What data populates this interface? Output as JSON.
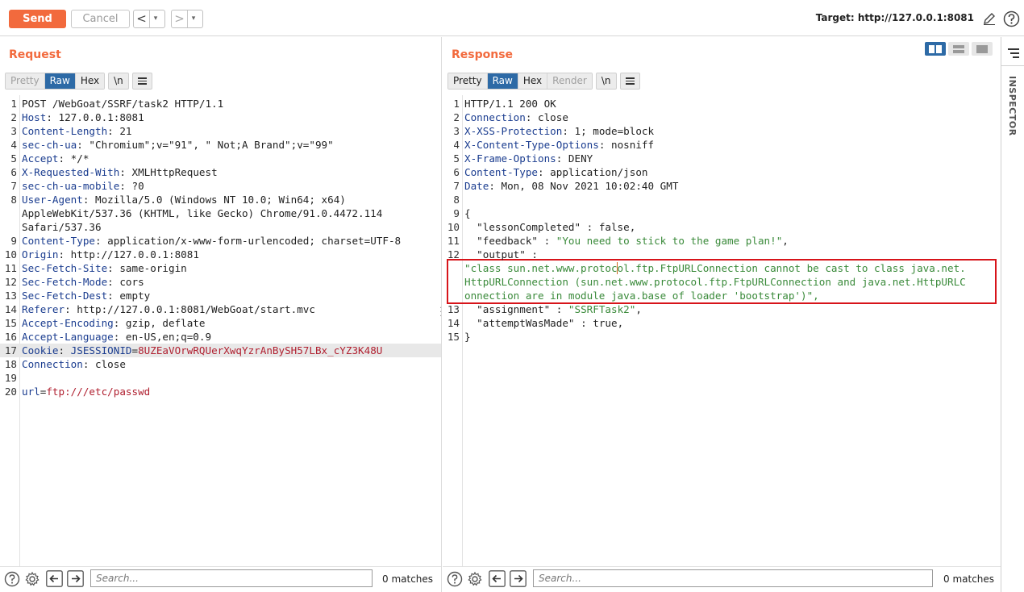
{
  "toolbar": {
    "send_label": "Send",
    "cancel_label": "Cancel",
    "back_glyph": "<",
    "forward_glyph": ">",
    "dropdown_glyph": "▾",
    "target_label": "Target: http://127.0.0.1:8081",
    "icons": [
      "edit-pencil-icon",
      "help-icon"
    ]
  },
  "request": {
    "title": "Request",
    "tabs": [
      "Pretty",
      "Raw",
      "Hex"
    ],
    "active_tab": "Raw",
    "newline_tab": "\\n",
    "lines": [
      {
        "n": "1",
        "name": "",
        "sep": "",
        "value": "POST /WebGoat/SSRF/task2 HTTP/1.1"
      },
      {
        "n": "2",
        "name": "Host",
        "sep": ": ",
        "value": "127.0.0.1:8081"
      },
      {
        "n": "3",
        "name": "Content-Length",
        "sep": ": ",
        "value": "21"
      },
      {
        "n": "4",
        "name": "sec-ch-ua",
        "sep": ": ",
        "value": "\"Chromium\";v=\"91\", \" Not;A Brand\";v=\"99\""
      },
      {
        "n": "5",
        "name": "Accept",
        "sep": ": ",
        "value": "*/*"
      },
      {
        "n": "6",
        "name": "X-Requested-With",
        "sep": ": ",
        "value": "XMLHttpRequest"
      },
      {
        "n": "7",
        "name": "sec-ch-ua-mobile",
        "sep": ": ",
        "value": "?0"
      },
      {
        "n": "8",
        "name": "User-Agent",
        "sep": ": ",
        "value": "Mozilla/5.0 (Windows NT 10.0; Win64; x64)"
      },
      {
        "n": "",
        "name": "",
        "sep": "",
        "value": "AppleWebKit/537.36 (KHTML, like Gecko) Chrome/91.0.4472.114"
      },
      {
        "n": "",
        "name": "",
        "sep": "",
        "value": "Safari/537.36"
      },
      {
        "n": "9",
        "name": "Content-Type",
        "sep": ": ",
        "value": "application/x-www-form-urlencoded; charset=UTF-8"
      },
      {
        "n": "10",
        "name": "Origin",
        "sep": ": ",
        "value": "http://127.0.0.1:8081"
      },
      {
        "n": "11",
        "name": "Sec-Fetch-Site",
        "sep": ": ",
        "value": "same-origin"
      },
      {
        "n": "12",
        "name": "Sec-Fetch-Mode",
        "sep": ": ",
        "value": "cors"
      },
      {
        "n": "13",
        "name": "Sec-Fetch-Dest",
        "sep": ": ",
        "value": "empty"
      },
      {
        "n": "14",
        "name": "Referer",
        "sep": ": ",
        "value": "http://127.0.0.1:8081/WebGoat/start.mvc"
      },
      {
        "n": "15",
        "name": "Accept-Encoding",
        "sep": ": ",
        "value": "gzip, deflate"
      },
      {
        "n": "16",
        "name": "Accept-Language",
        "sep": ": ",
        "value": "en-US,en;q=0.9"
      },
      {
        "n": "17",
        "name": "Cookie",
        "sep": ": ",
        "value": "",
        "cookie_name": "JSESSIONID",
        "cookie_value": "8UZEaVOrwRQUerXwqYzrAnBySH57LBx_cYZ3K48U",
        "highlight": true
      },
      {
        "n": "18",
        "name": "Connection",
        "sep": ": ",
        "value": "close"
      },
      {
        "n": "19",
        "name": "",
        "sep": "",
        "value": ""
      },
      {
        "n": "20",
        "name": "url",
        "sep": "=",
        "value": "ftp:///etc/passwd",
        "body": true
      }
    ]
  },
  "response": {
    "title": "Response",
    "tabs": [
      "Pretty",
      "Raw",
      "Hex",
      "Render"
    ],
    "active_tab": "Raw",
    "newline_tab": "\\n",
    "headers": [
      {
        "n": "1",
        "name": "",
        "value": "HTTP/1.1 200 OK"
      },
      {
        "n": "2",
        "name": "Connection",
        "value": "close"
      },
      {
        "n": "3",
        "name": "X-XSS-Protection",
        "value": "1; mode=block"
      },
      {
        "n": "4",
        "name": "X-Content-Type-Options",
        "value": "nosniff"
      },
      {
        "n": "5",
        "name": "X-Frame-Options",
        "value": "DENY"
      },
      {
        "n": "6",
        "name": "Content-Type",
        "value": "application/json"
      },
      {
        "n": "7",
        "name": "Date",
        "value": "Mon, 08 Nov 2021 10:02:40 GMT"
      },
      {
        "n": "8",
        "name": "",
        "value": ""
      }
    ],
    "json_lines": [
      {
        "n": "9",
        "text": "{"
      },
      {
        "n": "10",
        "key": "\"lessonCompleted\"",
        "value": "false",
        "value_type": "plain"
      },
      {
        "n": "11",
        "key": "\"feedback\"",
        "value": "\"You need to stick to the game plan!\"",
        "value_type": "string"
      },
      {
        "n": "12",
        "key": "\"output\"",
        "value": "",
        "value_type": "plain"
      }
    ],
    "output_lines": [
      "\"class sun.net.www.protocol.ftp.FtpURLConnection cannot be cast to class java.net.",
      "HttpURLConnection (sun.net.www.protocol.ftp.FtpURLConnection and java.net.HttpURLC",
      "onnection are in module java.base of loader 'bootstrap')\","
    ],
    "tail_lines": [
      {
        "n": "13",
        "key": "\"assignment\"",
        "value": "\"SSRFTask2\"",
        "value_type": "string"
      },
      {
        "n": "14",
        "key": "\"attemptWasMade\"",
        "value": "true",
        "value_type": "plain"
      },
      {
        "n": "15",
        "text": "}"
      }
    ]
  },
  "search": {
    "placeholder": "Search...",
    "request_matches": "0 matches",
    "response_matches": "0 matches"
  },
  "inspector": {
    "label": "INSPECTOR"
  },
  "colors": {
    "accent": "#f26a3d",
    "active_tab": "#2d6aa6",
    "header_name": "#1a3c8f",
    "string_value": "#3a8a3a",
    "cookie_value": "#b02030",
    "highlight_box": "#d7141a"
  }
}
